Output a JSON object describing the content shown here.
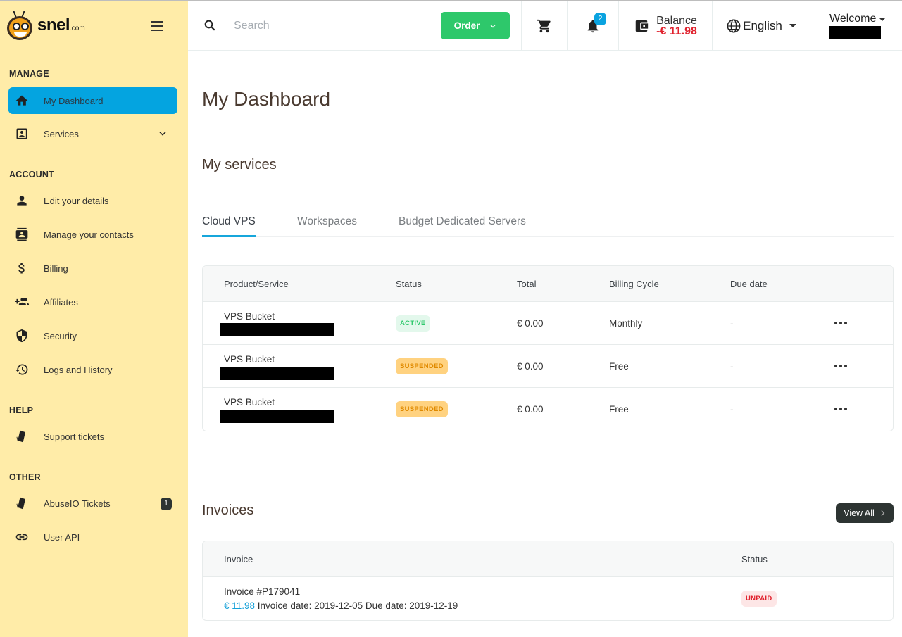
{
  "brand": {
    "name": "snel",
    "suffix": ".com"
  },
  "sidebar": {
    "sections": [
      {
        "title": "MANAGE"
      },
      {
        "title": "ACCOUNT"
      },
      {
        "title": "HELP"
      },
      {
        "title": "OTHER"
      }
    ],
    "items": [
      {
        "label": "My Dashboard",
        "icon": "home-icon",
        "active": true
      },
      {
        "label": "Services",
        "icon": "contact-card-icon",
        "expandable": true
      },
      {
        "label": "Edit your details",
        "icon": "person-icon"
      },
      {
        "label": "Manage your contacts",
        "icon": "contacts-icon"
      },
      {
        "label": "Billing",
        "icon": "dollar-icon"
      },
      {
        "label": "Affiliates",
        "icon": "group-add-icon"
      },
      {
        "label": "Security",
        "icon": "shield-icon"
      },
      {
        "label": "Logs and History",
        "icon": "history-icon"
      },
      {
        "label": "Support tickets",
        "icon": "tickets-icon"
      },
      {
        "label": "AbuseIO Tickets",
        "icon": "tickets-icon",
        "badge": "1"
      },
      {
        "label": "User API",
        "icon": "link-icon"
      }
    ]
  },
  "topbar": {
    "search_placeholder": "Search",
    "order_label": "Order",
    "notification_count": "2",
    "balance_label": "Balance",
    "balance_value": "-€ 11.98",
    "language": "English",
    "welcome_label": "Welcome"
  },
  "main": {
    "title": "My Dashboard",
    "services_title": "My services",
    "tabs": [
      {
        "label": "Cloud VPS",
        "active": true
      },
      {
        "label": "Workspaces"
      },
      {
        "label": "Budget Dedicated Servers"
      }
    ],
    "services_table": {
      "columns": [
        "Product/Service",
        "Status",
        "Total",
        "Billing Cycle",
        "Due date"
      ],
      "rows": [
        {
          "product": "VPS Bucket",
          "status": "ACTIVE",
          "total": "€ 0.00",
          "cycle": "Monthly",
          "due": "-"
        },
        {
          "product": "VPS Bucket",
          "status": "SUSPENDED",
          "total": "€ 0.00",
          "cycle": "Free",
          "due": "-"
        },
        {
          "product": "VPS Bucket",
          "status": "SUSPENDED",
          "total": "€ 0.00",
          "cycle": "Free",
          "due": "-"
        }
      ]
    },
    "invoices_title": "Invoices",
    "view_all_label": "View All",
    "invoices_table": {
      "columns": [
        "Invoice",
        "Status"
      ],
      "rows": [
        {
          "number": "Invoice #P179041",
          "amount": "€ 11.98",
          "details": " Invoice date: 2019-12-05 Due date: 2019-12-19",
          "status": "UNPAID"
        }
      ]
    }
  },
  "colors": {
    "sidebar_bg": "#ffeca8",
    "accent_blue": "#04a4e0",
    "order_green": "#2ec86b",
    "danger_red": "#e0202c",
    "warning_orange": "#ffd280"
  }
}
